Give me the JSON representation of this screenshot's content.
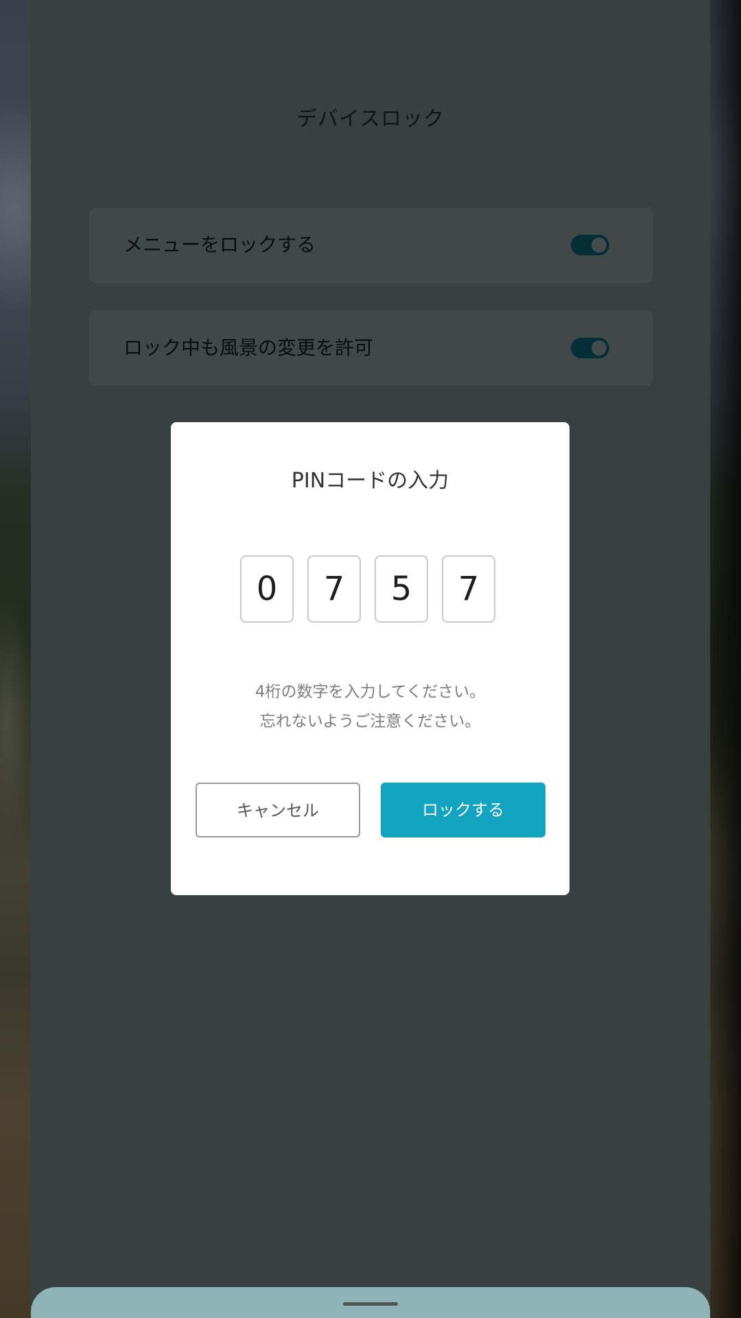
{
  "settings": {
    "title": "デバイスロック",
    "items": [
      {
        "label": "メニューをロックする",
        "enabled": true
      },
      {
        "label": "ロック中も風景の変更を許可",
        "enabled": true
      }
    ]
  },
  "dialog": {
    "title": "PINコードの入力",
    "pin_digits": [
      "0",
      "7",
      "5",
      "7"
    ],
    "hint_line1": "4桁の数字を入力してください。",
    "hint_line2": "忘れないようご注意ください。",
    "cancel_label": "キャンセル",
    "lock_label": "ロックする"
  },
  "colors": {
    "accent": "#11a3bf",
    "toggle_on": "#0b4b5a"
  }
}
